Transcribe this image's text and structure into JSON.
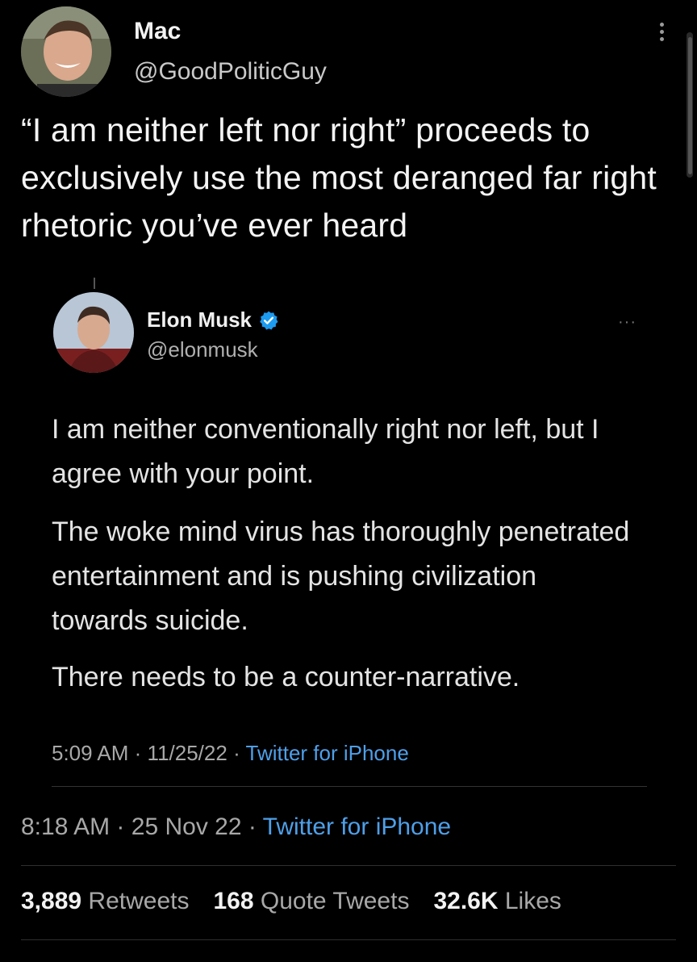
{
  "tweet": {
    "author_name": "Mac",
    "author_handle": "@GoodPoliticGuy",
    "text": "“I am neither left nor right” proceeds to exclusively use the most deranged far right rhetoric you’ve ever heard",
    "time": "8:18 AM",
    "date": "25 Nov 22",
    "source": "Twitter for iPhone",
    "sep": "·"
  },
  "quoted": {
    "author_name": "Elon Musk",
    "author_handle": "@elonmusk",
    "more_label": "···",
    "paragraphs": [
      "I am neither conventionally right nor left, but I agree with your point.",
      "The woke mind virus has thoroughly penetrated entertainment and is pushing civilization towards suicide.",
      "There needs to be a counter-narrative."
    ],
    "time": "5:09 AM",
    "date": "11/25/22",
    "source": "Twitter for iPhone",
    "sep": "·"
  },
  "stats": {
    "retweets_count": "3,889",
    "retweets_label": "Retweets",
    "quotes_count": "168",
    "quotes_label": "Quote Tweets",
    "likes_count": "32.6K",
    "likes_label": "Likes"
  },
  "icons": {
    "menu": "kebab-menu-icon",
    "verified": "verified-badge-icon"
  },
  "colors": {
    "background": "#000000",
    "link": "#4f9fe8",
    "verified": "#1d9bf0"
  }
}
